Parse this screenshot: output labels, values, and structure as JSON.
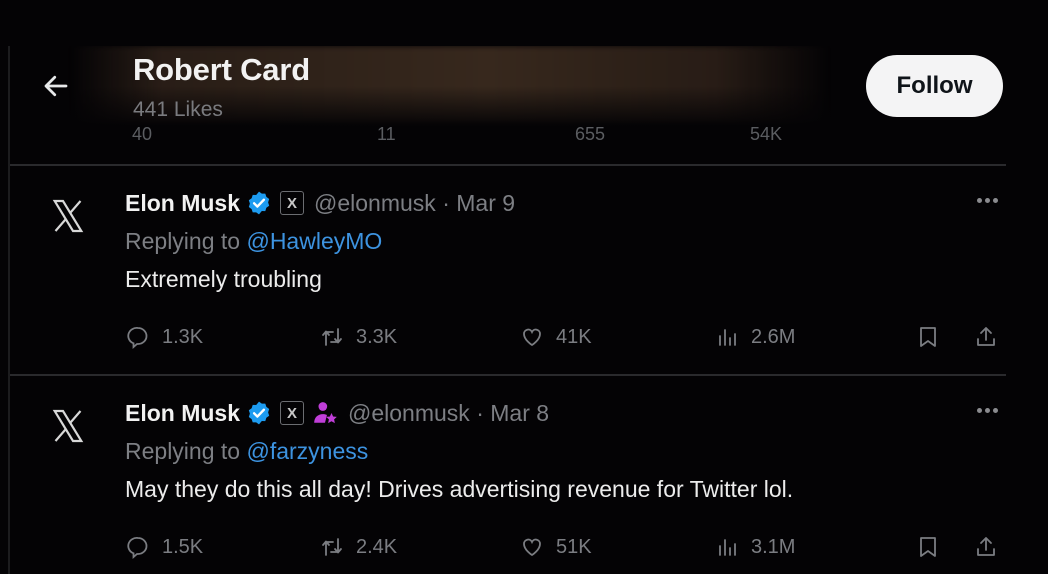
{
  "header": {
    "title": "Robert Card",
    "subtitle": "441 Likes",
    "follow_label": "Follow",
    "back_icon": "arrow-left-icon",
    "partial_prev_stats": [
      "40",
      "11",
      "655",
      "54K"
    ]
  },
  "tweets": [
    {
      "name": "Elon Musk",
      "handle": "@elonmusk",
      "dot": "·",
      "date": "Mar 9",
      "replying_prefix": "Replying to ",
      "replying_to": "@HawleyMO",
      "text": "Extremely troubling",
      "has_affiliate_badge": false,
      "stats": {
        "replies": "1.3K",
        "reposts": "3.3K",
        "likes": "41K",
        "views": "2.6M"
      }
    },
    {
      "name": "Elon Musk",
      "handle": "@elonmusk",
      "dot": "·",
      "date": "Mar 8",
      "replying_prefix": "Replying to ",
      "replying_to": "@farzyness",
      "text": "May they do this all day! Drives advertising revenue for Twitter lol.",
      "has_affiliate_badge": true,
      "stats": {
        "replies": "1.5K",
        "reposts": "2.4K",
        "likes": "51K",
        "views": "3.1M"
      }
    }
  ],
  "badges": {
    "x_label": "X",
    "avatar_glyph": "X"
  },
  "colors": {
    "verified": "#1d9bf0",
    "mention": "#3d93e0",
    "affiliate": "#c03ed8",
    "background": "#040305"
  }
}
